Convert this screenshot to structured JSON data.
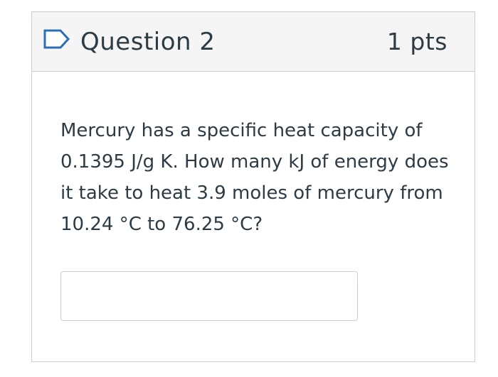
{
  "question": {
    "title": "Question 2",
    "points": "1 pts",
    "flag_icon": "flag-outline-icon",
    "text": "Mercury has a specific heat capacity of 0.1395 J/g K. How many kJ of energy does it take to heat 3.9 moles of mercury from 10.24 °C to 76.25 °C?",
    "answer": {
      "value": "",
      "placeholder": ""
    }
  },
  "colors": {
    "header_background": "#f5f5f5",
    "border": "#c7cdd1",
    "text": "#2d3b45",
    "flag_outline": "#2b6fb6"
  }
}
